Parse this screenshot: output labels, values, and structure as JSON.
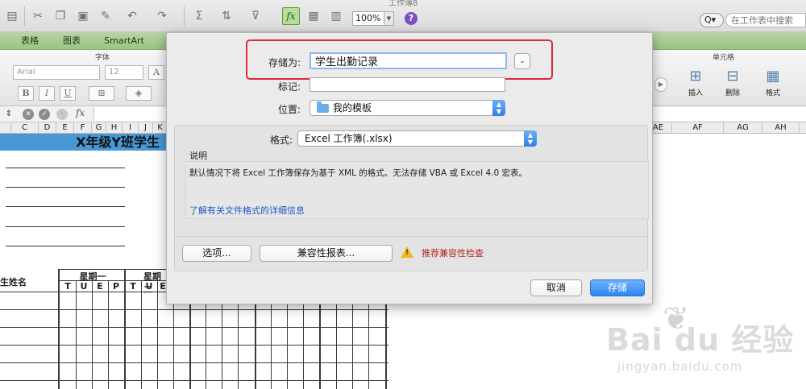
{
  "window": {
    "title": "工作簿8"
  },
  "toolbar": {
    "zoom": "100%",
    "search_placeholder": "在工作表中搜索",
    "search_icon_label": "Q▾",
    "fx": "fx",
    "help": "?"
  },
  "ribbon": {
    "tabs": [
      "表格",
      "图表",
      "SmartArt"
    ],
    "font_group_title": "字体",
    "font_name": "Arial",
    "font_size": "12",
    "bold": "B",
    "italic": "I",
    "underline": "U",
    "cells_group_title": "单元格",
    "cell_actions": [
      "插入",
      "删除",
      "格式"
    ]
  },
  "formula_bar": {
    "fx": "fx"
  },
  "columns": {
    "left": [
      "C",
      "D",
      "E",
      "F",
      "G",
      "H",
      "I",
      "J",
      "K"
    ],
    "right": [
      "AE",
      "AF",
      "AG",
      "AH"
    ]
  },
  "sheet": {
    "title_partial": "X年级Y班学生",
    "student_name_header": "生姓名",
    "week1": "星期一",
    "week2": "星期二",
    "week1_letters": [
      "T",
      "U",
      "E",
      "P"
    ],
    "week2_letters": [
      "T",
      "U",
      "E"
    ]
  },
  "dialog": {
    "save_as_label": "存储为:",
    "save_as_value": "学生出勤记录",
    "tags_label": "标记:",
    "tags_value": "",
    "location_label": "位置:",
    "location_value": "我的模板",
    "format_label": "格式:",
    "format_value": "Excel 工作簿(.xlsx)",
    "description_title": "说明",
    "description_text": "默认情况下将 Excel 工作簿保存为基于 XML 的格式。无法存储 VBA 或 Excel 4.0 宏表。",
    "learn_more_link": "了解有关文件格式的详细信息",
    "options_button": "选项...",
    "compat_report_button": "兼容性报表...",
    "compat_warning": "推荐兼容性检查",
    "cancel_button": "取消",
    "save_button": "存储",
    "chevron": "⌄",
    "highlight_color": "#dd2b3a",
    "accent_color": "#2c86f1"
  },
  "watermark": {
    "logo": "Bai du 经验",
    "url": "jingyan.baidu.com"
  }
}
